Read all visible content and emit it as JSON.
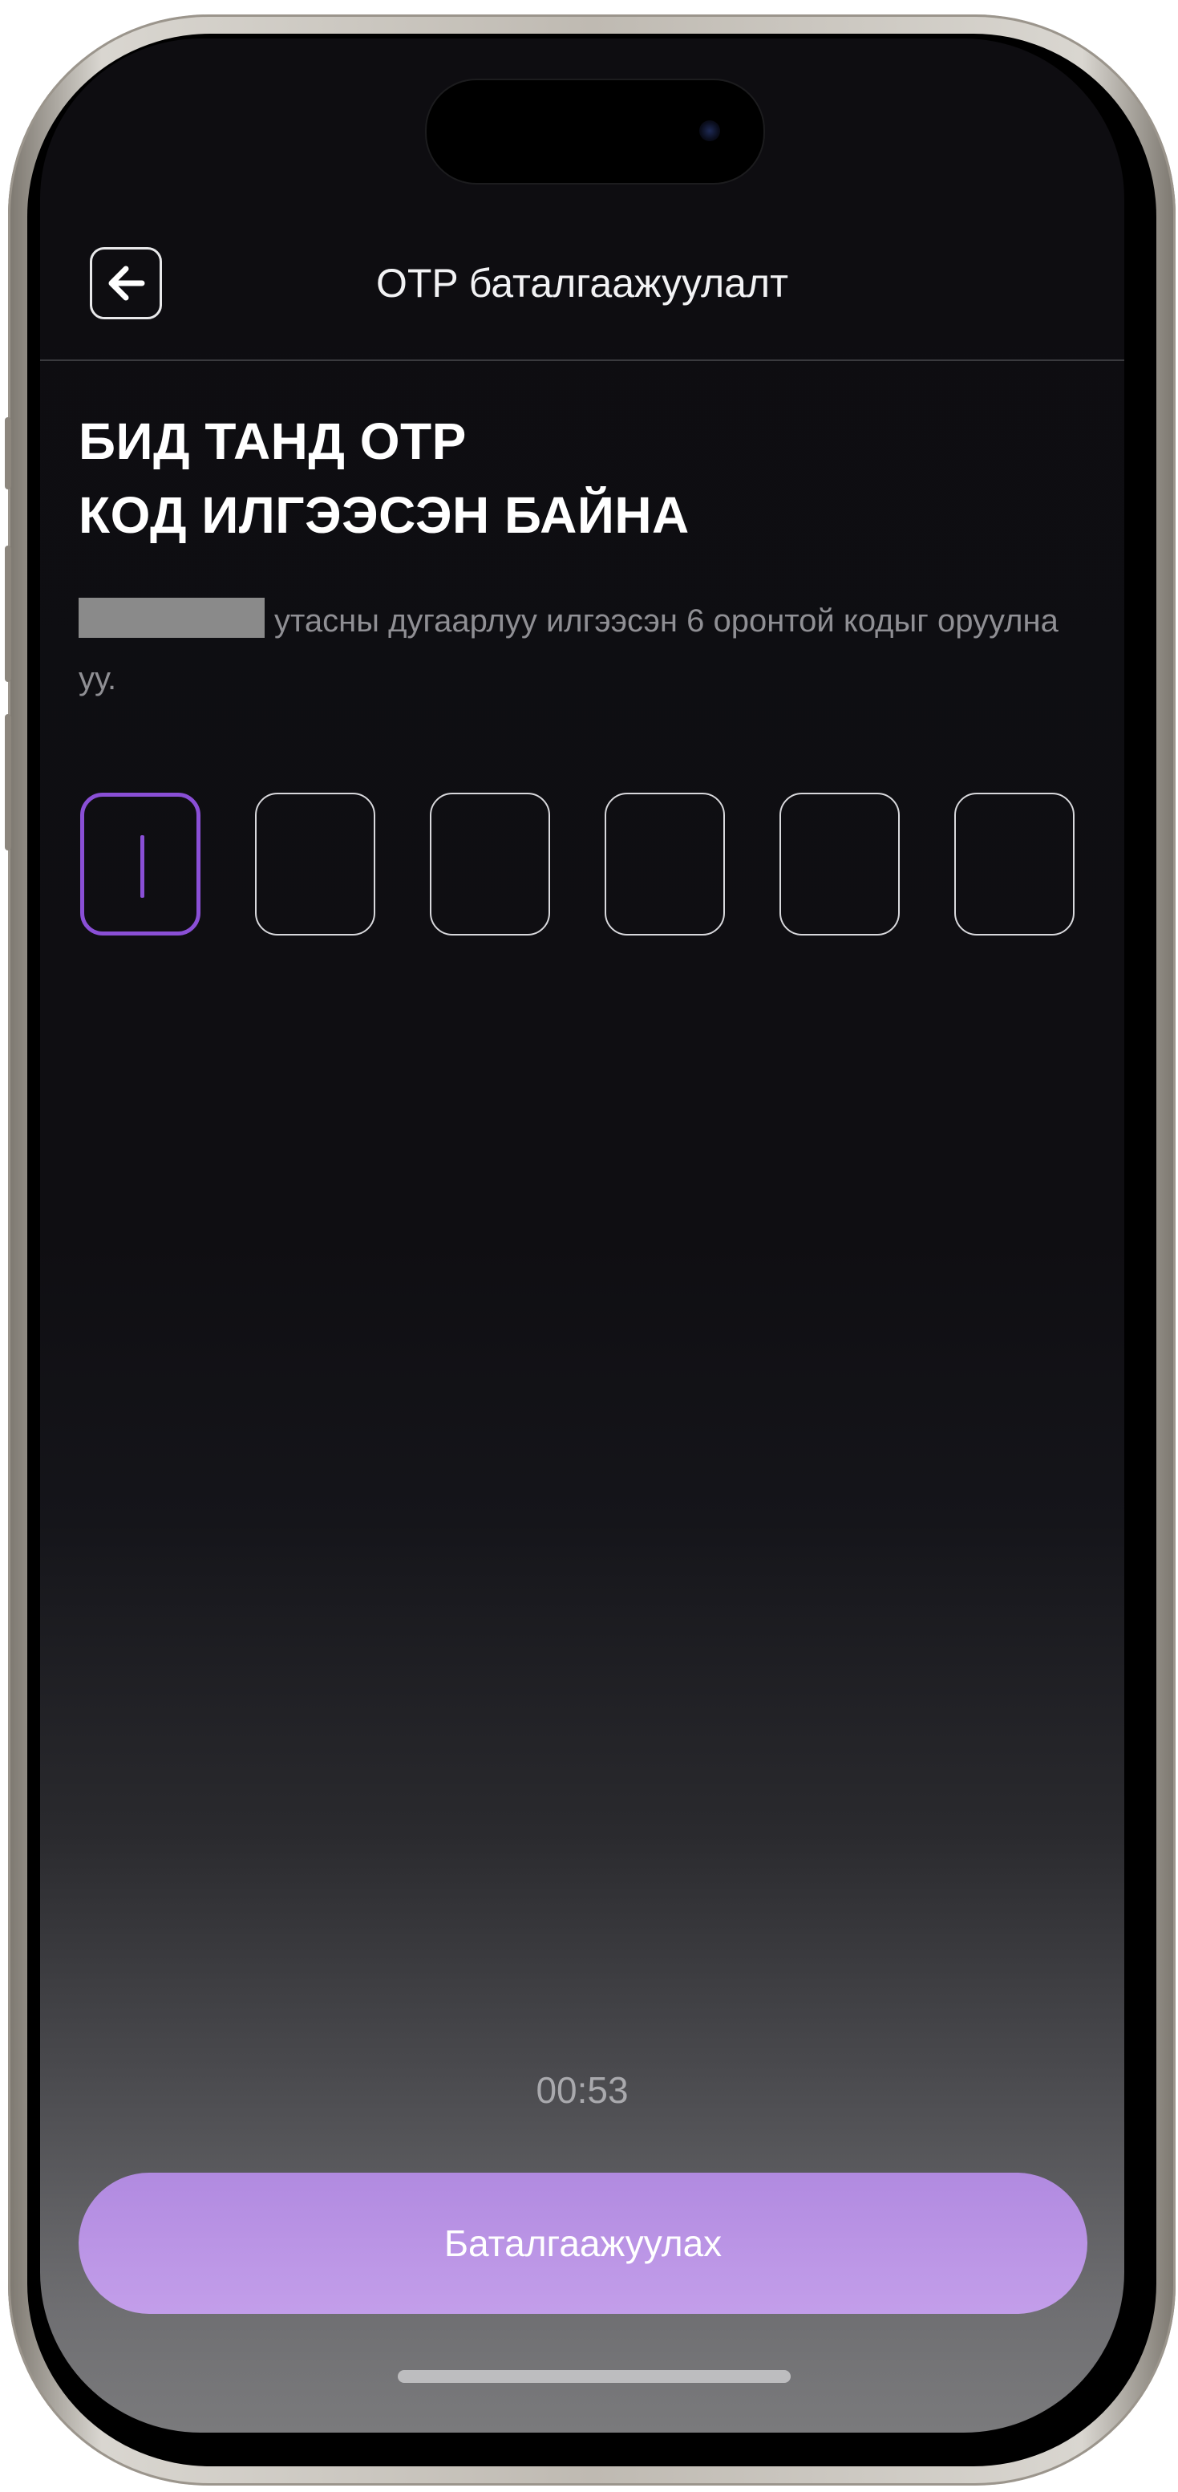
{
  "header": {
    "title": "OTP баталгаажуулалт",
    "back_icon": "arrow-left-icon"
  },
  "headline": {
    "line1": "БИД ТАНД OTP",
    "line2": "КОД ИЛГЭЭСЭН БАЙНА"
  },
  "description": {
    "text": "утасны дугаарлуу илгээсэн 6 оронтой кодыг оруулна уу."
  },
  "otp": {
    "digits": [
      "",
      "",
      "",
      "",
      "",
      ""
    ],
    "active_index": 0
  },
  "timer": {
    "value": "00:53"
  },
  "confirm_button": {
    "label": "Баталгаажуулах"
  },
  "colors": {
    "accent": "#8a4fd6",
    "button": "#c39eea",
    "background": "#0e0d11"
  }
}
